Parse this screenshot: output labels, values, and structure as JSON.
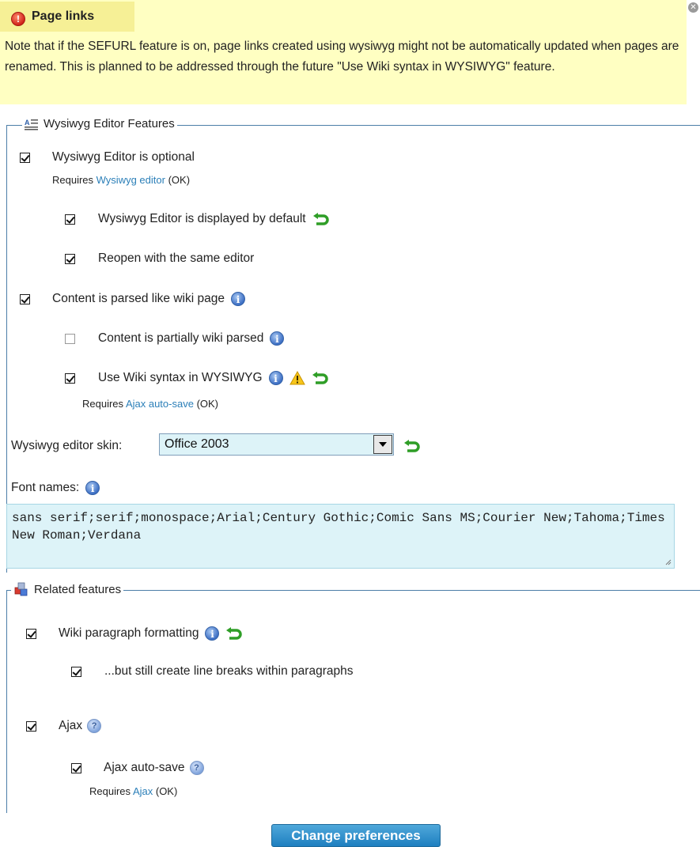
{
  "notice": {
    "title": "Page links",
    "text": "Note that if the SEFURL feature is on, page links created using wysiwyg might not be automatically updated when pages are renamed. This is planned to be addressed through the future \"Use Wiki syntax in WYSIWYG\" feature.",
    "icon": "error-icon",
    "close_icon": "close-icon"
  },
  "wysiwyg_section": {
    "legend": "Wysiwyg Editor Features",
    "items": [
      {
        "label": "Wysiwyg Editor is optional",
        "checked": true,
        "requires_prefix": "Requires",
        "requires_link": "Wysiwyg editor",
        "requires_status": "(OK)"
      },
      {
        "label": "Wysiwyg Editor is displayed by default",
        "checked": true
      },
      {
        "label": "Reopen with the same editor",
        "checked": true
      },
      {
        "label": "Content is parsed like wiki page",
        "checked": true
      },
      {
        "label": "Content is partially wiki parsed",
        "checked": false
      },
      {
        "label": "Use Wiki syntax in WYSIWYG",
        "checked": true,
        "requires_prefix": "Requires",
        "requires_link": "Ajax auto-save",
        "requires_status": "(OK)"
      }
    ],
    "skin": {
      "label": "Wysiwyg editor skin:",
      "value": "Office 2003"
    },
    "fonts": {
      "label": "Font names:",
      "value": "sans serif;serif;monospace;Arial;Century Gothic;Comic Sans MS;Courier New;Tahoma;Times New Roman;Verdana"
    }
  },
  "related_section": {
    "legend": "Related features",
    "items": [
      {
        "label": "Wiki paragraph formatting",
        "checked": true
      },
      {
        "label": "...but still create line breaks within paragraphs",
        "checked": true
      },
      {
        "label": "Ajax",
        "checked": true
      },
      {
        "label": "Ajax auto-save",
        "checked": true,
        "requires_prefix": "Requires",
        "requires_link": "Ajax",
        "requires_status": "(OK)"
      }
    ]
  },
  "submit_label": "Change preferences",
  "colors": {
    "notice_bg": "#ffffc2",
    "notice_header": "#f6f096",
    "border": "#4c7ea8",
    "link": "#2b7fb8",
    "field_bg": "#ddf3f8",
    "button": "#1e7fc0"
  }
}
